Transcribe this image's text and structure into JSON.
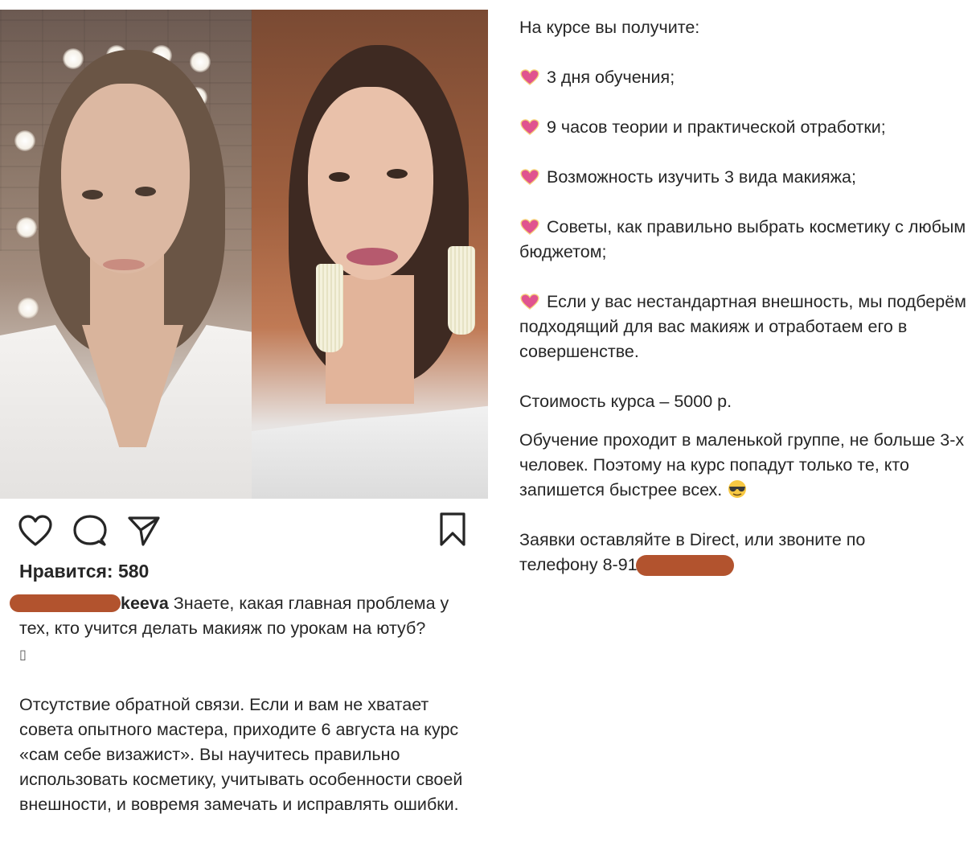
{
  "post": {
    "likes_label": "Нравится: 580",
    "username_suffix": "keeva",
    "caption_line_1": "Знаете, какая главная проблема у тех, кто учится делать макияж по урокам на ютуб?",
    "caption_missing_char": "▯",
    "caption_paragraph_2": "Отсутствие обратной связи. Если и вам не хватает совета опытного мастера, приходите 6 августа на курс «сам себе визажист». Вы научитесь правильно использовать косметику, учитывать особенности своей внешности, и вовремя замечать и исправлять ошибки."
  },
  "actions": {
    "like_icon": "heart-outline-icon",
    "comment_icon": "speech-bubble-icon",
    "share_icon": "paper-plane-icon",
    "save_icon": "bookmark-icon"
  },
  "course": {
    "intro": "На курсе вы получите:",
    "bullets": [
      "3 дня обучения;",
      "9 часов теории и практической отработки;",
      "Возможность изучить 3 вида макияжа;",
      "Советы, как правильно выбрать косметику с любым бюджетом;",
      "Если у вас нестандартная внешность, мы подберём подходящий для вас макияж и отработаем его в совершенстве."
    ],
    "price": "Стоимость курса – 5000 р.",
    "group_note": "Обучение проходит в маленькой группе, не больше 3-х человек. Поэтому на курс попадут только те, кто запишется быстрее всех.",
    "contacts_line_1": "Заявки оставляйте в Direct, или звоните по",
    "contacts_line_2": "телефону 8-91"
  },
  "colors": {
    "text": "#262626",
    "redaction": "#b2532e",
    "heart_bullet": "#e0548f"
  }
}
